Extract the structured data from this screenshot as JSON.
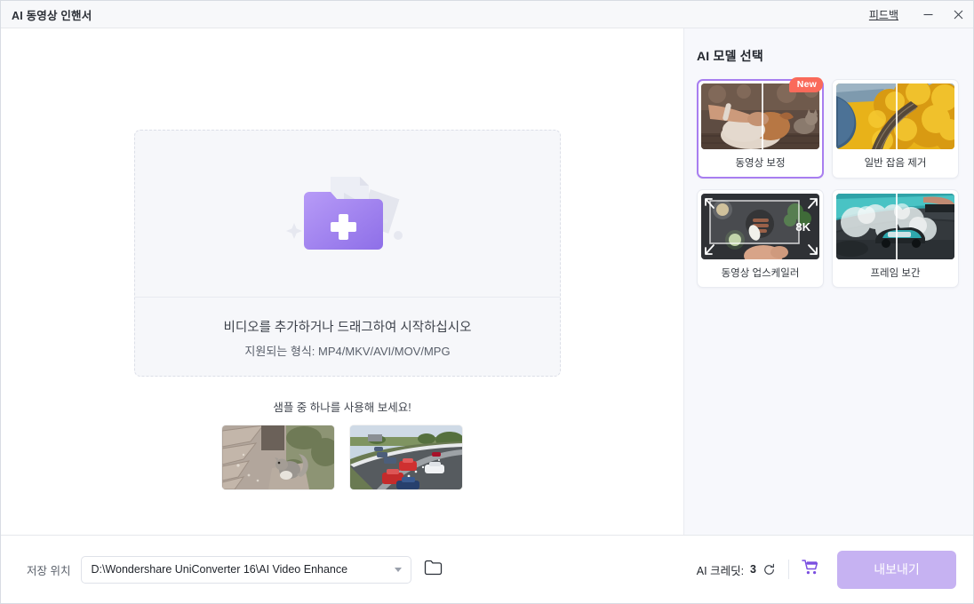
{
  "titlebar": {
    "title": "AI 동영상 인핸서",
    "feedback_label": "피드백",
    "minimize_label": "—",
    "close_label": "✕"
  },
  "main": {
    "dropzone": {
      "primary_text": "비디오를 추가하거나 드래그하여 시작하십시오",
      "secondary_text": "지원되는 형식: MP4/MKV/AVI/MOV/MPG",
      "icon_name": "add-folder-icon"
    },
    "samples": {
      "title": "샘플 중 하나를 사용해 보세요!",
      "items": [
        {
          "name": "squirrel-on-bench",
          "alt": "다람쥐 샘플"
        },
        {
          "name": "highway-traffic",
          "alt": "고속도로 샘플"
        }
      ]
    }
  },
  "sidebar": {
    "title": "AI 모델 선택",
    "models": [
      {
        "label": "동영상 보정",
        "badge": "New",
        "selected": true,
        "thumb": "dog-paw"
      },
      {
        "label": "일반 잡음 제거",
        "badge": "",
        "selected": false,
        "thumb": "autumn-river"
      },
      {
        "label": "동영상 업스케일러",
        "badge": "8K",
        "selected": false,
        "thumb": "food-table"
      },
      {
        "label": "프레임 보간",
        "badge": "",
        "selected": false,
        "thumb": "drift-car"
      }
    ]
  },
  "bottombar": {
    "save_location_label": "저장 위치",
    "save_location_value": "D:\\Wondershare UniConverter 16\\AI Video Enhance",
    "credits_label": "AI 크레딧:",
    "credits_value": "3",
    "refresh_icon": "refresh-icon",
    "cart_icon": "shopping-cart-icon",
    "export_label": "내보내기"
  },
  "colors": {
    "accent": "#a87ef0",
    "export_disabled": "#c6b2f2",
    "badge_new": "#fa6a5a",
    "sidebar_bg": "#f7f8fc",
    "dropzone_bg": "#f6f7fa"
  }
}
